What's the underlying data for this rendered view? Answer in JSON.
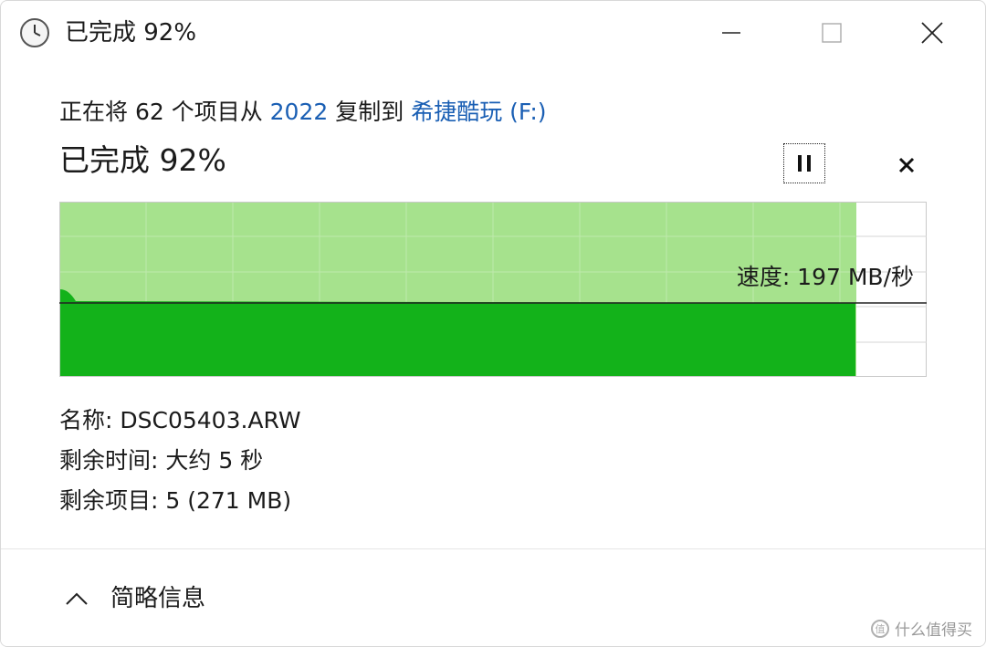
{
  "window": {
    "title": "已完成 92%"
  },
  "copy": {
    "prefix": "正在将 62 个项目从 ",
    "source": "2022",
    "middle": " 复制到 ",
    "destination": "希捷酷玩 (F:)",
    "status": "已完成 92%",
    "progress_fraction": 0.92,
    "speed_label": "速度: 197 MB/秒"
  },
  "details": {
    "name_label": "名称: ",
    "name_value": "DSC05403.ARW",
    "time_label": "剩余时间: ",
    "time_value": "大约 5 秒",
    "items_label": "剩余项目: ",
    "items_value": "5 (271 MB)"
  },
  "footer": {
    "toggle_label": "简略信息"
  },
  "watermark": {
    "text": "什么值得买"
  },
  "colors": {
    "progress_light": "#a6e28d",
    "progress_dark": "#13b21a",
    "link": "#1a5fb4"
  },
  "icons": {
    "title": "clock-icon",
    "minimize": "minimize-icon",
    "maximize": "maximize-icon",
    "close": "close-icon",
    "pause": "pause-icon",
    "cancel": "cancel-icon",
    "toggle": "chevron-up-icon"
  }
}
